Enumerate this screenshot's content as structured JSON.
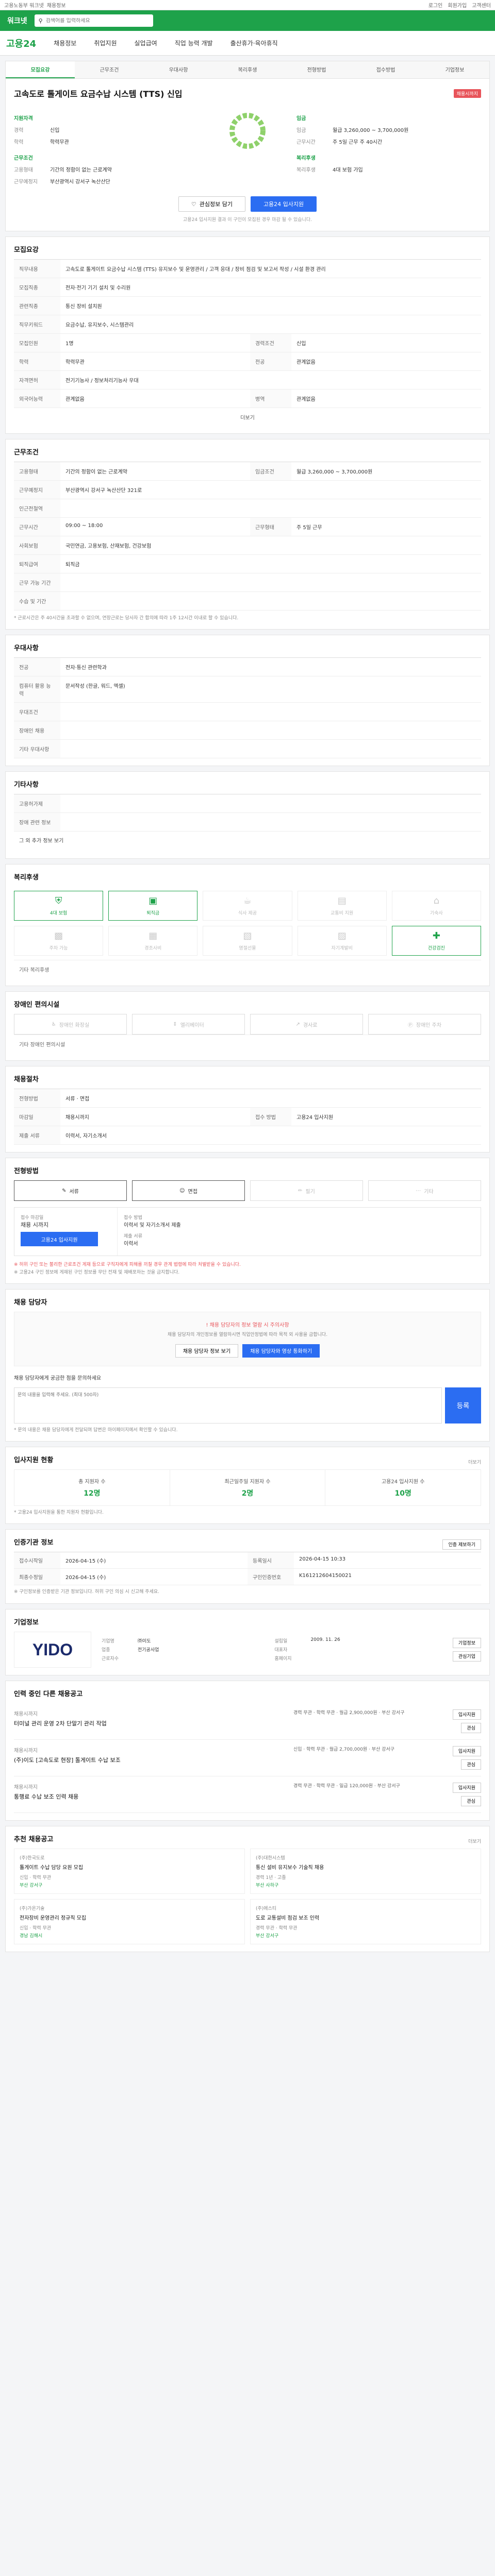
{
  "topbar": {
    "left": "고용노동부 워크넷",
    "crumb": "채용정보",
    "links": [
      "로그인",
      "회원가입",
      "고객센터"
    ]
  },
  "search": {
    "logo": "워크넷",
    "placeholder": "검색어를 입력하세요"
  },
  "gnb": {
    "brand": "고용24",
    "menus": [
      "채용정보",
      "취업지원",
      "실업급여",
      "직업 능력 개발",
      "출산휴가·육아휴직"
    ]
  },
  "head": {
    "tabs": [
      "모집요강",
      "근무조건",
      "우대사항",
      "복리후생",
      "전형방법",
      "접수방법",
      "기업정보"
    ],
    "title": "고속도로 톨게이트 요금수납 시스템 (TTS) 신입",
    "dday": "채용시까지",
    "section1": "지원자격",
    "kv1": [
      {
        "k": "경력",
        "v": "신입"
      },
      {
        "k": "학력",
        "v": "학력무관"
      }
    ],
    "section2": "근무조건",
    "kv2": [
      {
        "k": "고용형태",
        "v": "기간의 정함이 없는 근로계약"
      },
      {
        "k": "근무예정지",
        "v": "부산광역시 강서구 녹산산단"
      }
    ],
    "section3": "임금",
    "kv3": [
      {
        "k": "임금",
        "v": "월급 3,260,000 ~ 3,700,000원"
      },
      {
        "k": "근무시간",
        "v": "주 5일 근무 주 40시간"
      }
    ],
    "section4": "복리후생",
    "kv4": [
      {
        "k": "복리후생",
        "v": "4대 보험 가입"
      }
    ],
    "btn_scrap": "관심정보 담기",
    "btn_apply": "고용24 입사지원",
    "note": "고용24 입사지원 결과 이 구인이 모집된 경우 마감 될 수 있습니다."
  },
  "recruit": {
    "title": "모집요강",
    "rows": [
      {
        "k": "직무내용",
        "v": "고속도로 톨게이트 요금수납 시스템 (TTS) 유지보수 및 운영관리 / 고객 응대 / 장비 점검 및 보고서 작성 / 시설 환경 관리"
      },
      {
        "k": "모집직종",
        "v": "전자·전기 기기 설치 및 수리원"
      },
      {
        "k": "관련직종",
        "v": "통신 장비 설치원"
      },
      {
        "k": "직무키워드",
        "v": "요금수납, 유지보수, 시스템관리"
      },
      {
        "k": "모집인원",
        "v": "1명"
      },
      {
        "k": "경력조건",
        "v": "신입"
      },
      {
        "k": "학력",
        "v": "학력무관"
      },
      {
        "k": "전공",
        "v": "관계없음"
      },
      {
        "k": "자격면허",
        "v": "전기기능사 / 정보처리기능사 우대"
      },
      {
        "k": "외국어능력",
        "v": "관계없음"
      },
      {
        "k": "병역",
        "v": "관계없음"
      }
    ],
    "more": "더보기"
  },
  "work": {
    "title": "근무조건",
    "rows": [
      {
        "k": "고용형태",
        "v": "기간의 정함이 없는 근로계약"
      },
      {
        "k": "임금조건",
        "v": "월급 3,260,000 ~ 3,700,000원"
      },
      {
        "k": "근무예정지",
        "v": "부산광역시 강서구 녹산산단 321로"
      },
      {
        "k": "인근전철역",
        "v": ""
      },
      {
        "k": "근무시간",
        "v": "09:00 ~ 18:00"
      },
      {
        "k": "근무형태",
        "v": "주 5일 근무"
      },
      {
        "k": "사회보험",
        "v": "국민연금, 고용보험, 산재보험, 건강보험"
      },
      {
        "k": "퇴직급여",
        "v": "퇴직금"
      },
      {
        "k": "근무 가능 기간",
        "v": ""
      },
      {
        "k": "수습 및 기간",
        "v": ""
      }
    ],
    "note": "* 근로시간은 주 40시간을 초과할 수 없으며, 연장근로는 당사자 간 합의에 따라 1주 12시간 이내로 할 수 있습니다."
  },
  "pref": {
    "title": "우대사항",
    "rows": [
      {
        "k": "전공",
        "v": "전자·통신 관련학과"
      },
      {
        "k": "컴퓨터 활용 능력",
        "v": "문서작성 (한글, 워드, 엑셀)"
      },
      {
        "k": "우대조건",
        "v": ""
      },
      {
        "k": "장애인 채용",
        "v": ""
      },
      {
        "k": "기타 우대사항",
        "v": ""
      }
    ]
  },
  "etc": {
    "title": "기타사항",
    "rows": [
      {
        "k": "고용허가제",
        "v": ""
      },
      {
        "k": "장애 관련 정보",
        "v": ""
      }
    ],
    "link": "그 외 추가 정보 보기"
  },
  "welfare": {
    "title": "복리후생",
    "tiles": [
      {
        "label": "4대 보험",
        "icon": "shield-icon",
        "on": true
      },
      {
        "label": "퇴직금",
        "icon": "wallet-icon",
        "on": true
      },
      {
        "label": "식사 제공",
        "icon": "meal-icon",
        "on": false
      },
      {
        "label": "교통비 지원",
        "icon": "bus-icon",
        "on": false
      },
      {
        "label": "기숙사",
        "icon": "home-icon",
        "on": false
      },
      {
        "label": "주차 가능",
        "icon": "car-icon",
        "on": false
      },
      {
        "label": "경조사비",
        "icon": "gift-icon",
        "on": false
      },
      {
        "label": "명절선물",
        "icon": "present-icon",
        "on": false
      },
      {
        "label": "자기계발비",
        "icon": "book-icon",
        "on": false
      },
      {
        "label": "건강검진",
        "icon": "health-icon",
        "on": true
      }
    ],
    "etc_k": "기타 복리후생",
    "etc_v": ""
  },
  "disabled": {
    "title": "장애인 편의시설",
    "tiles": [
      {
        "label": "장애인 화장실",
        "icon": "toilet-icon"
      },
      {
        "label": "엘리베이터",
        "icon": "elevator-icon"
      },
      {
        "label": "경사로",
        "icon": "ramp-icon"
      },
      {
        "label": "장애인 주차",
        "icon": "parking-icon"
      }
    ],
    "etc_k": "기타 장애인 편의시설",
    "etc_v": ""
  },
  "hire": {
    "title": "채용절차",
    "rows": [
      {
        "k": "전형방법",
        "v": "서류 · 면접"
      },
      {
        "k": "마감일",
        "v": "채용시까지"
      },
      {
        "k": "접수 방법",
        "v": "고용24 입사지원"
      },
      {
        "k": "제출 서류",
        "v": "이력서, 자기소개서"
      }
    ]
  },
  "method": {
    "title": "전형방법",
    "items": [
      "서류",
      "면접",
      "필기",
      "기타"
    ],
    "on": [
      true,
      true,
      false,
      false
    ]
  },
  "apply": {
    "left_title": "접수 마감일",
    "left_value": "채용 시까지",
    "apply_btn": "고용24 입사지원",
    "right_title": "접수 방법",
    "right_value": "이력서 및 자기소개서 제출",
    "right_title2": "제출 서류",
    "right_value2": "이력서",
    "notice_red": "※ 허위 구인 또는 불리한 근로조건 게재 등으로 구직자에게 피해를 끼칠 경우 관계 법령에 따라 처벌받을 수 있습니다.",
    "notice_gray": "※ 고용24 구인 정보에 게재된 구인 정보를 무단 전재 및 재배포하는 것을 금지합니다."
  },
  "contact": {
    "title": "채용 담당자",
    "alert": "! 채용 담당자의 정보 열람 시 주의사항",
    "desc": "채용 담당자의 개인정보를 열람하시면 직업안정법에 따라 목적 외 사용을 금합니다.",
    "btn1": "채용 담당자 정보 보기",
    "btn2": "채용 담당자와 영상 통화하기",
    "qa_title": "채용 담당자에게 궁금한 점을 문의하세요",
    "qa_placeholder": "문의 내용을 입력해 주세요. (최대 500자)",
    "qa_btn": "등록",
    "list_note": "* 문의 내용은 채용 담당자에게 전달되며 답변은 마이페이지에서 확인할 수 있습니다."
  },
  "stats": {
    "title": "입사지원 현황",
    "link": "더보기",
    "items": [
      {
        "label": "총 지원자 수",
        "num": "12명"
      },
      {
        "label": "최근일주일 지원자 수",
        "num": "2명"
      },
      {
        "label": "고용24 입사지원 수",
        "num": "10명"
      }
    ],
    "note": "* 고용24 입사지원을 통한 지원자 현황입니다."
  },
  "dates": {
    "title": "인증기관 정보",
    "link": "인증 제보하기",
    "rows": [
      {
        "k": "접수시작일",
        "v": "2026-04-15 (수)"
      },
      {
        "k": "등록일시",
        "v": "2026-04-15 10:33"
      },
      {
        "k": "최종수정일",
        "v": "2026-04-15 (수)"
      },
      {
        "k": "구인인증번호",
        "v": "K161212604150021"
      }
    ],
    "notes": "※ 구인정보를 인증받은 기관 정보입니다. 허위 구인 의심 시 신고해 주세요."
  },
  "company": {
    "title": "기업정보",
    "logo": "YIDO",
    "kv": [
      {
        "k": "기업명",
        "v": "㈜이도"
      },
      {
        "k": "설립일",
        "v": "2009. 11. 26"
      },
      {
        "k": "업종",
        "v": "전기공사업"
      },
      {
        "k": "대표자",
        "v": ""
      },
      {
        "k": "근로자수",
        "v": ""
      },
      {
        "k": "홈페이지",
        "v": ""
      }
    ],
    "btn1": "기업정보",
    "btn2": "관심기업"
  },
  "others": {
    "title": "인력 중인 다른 채용공고",
    "items": [
      {
        "co": "채용시까지",
        "tt": "터미널 관리 운영 2차 단말기 관리 작업",
        "meta": "경력 무관 · 학력 무관 · 월급 2,900,000원 · 부산 강서구",
        "b1": "입사지원",
        "b2": "관심"
      },
      {
        "co": "채용시까지",
        "tt": "(주)이도 [고속도로 현장] 톨게이트 수납 보조",
        "meta": "신입 · 학력 무관 · 월급 2,700,000원 · 부산 강서구",
        "b1": "입사지원",
        "b2": "관심"
      },
      {
        "co": "채용시까지",
        "tt": "통행료 수납 보조 인력 채용",
        "meta": "경력 무관 · 학력 무관 · 일급 120,000원 · 부산 강서구",
        "b1": "입사지원",
        "b2": "관심"
      }
    ]
  },
  "recommend": {
    "title": "추천 채용공고",
    "link": "더보기",
    "items": [
      {
        "co": "(주)한국도로",
        "tt": "톨게이트 수납 담당 요원 모집",
        "mt": "신입 · 학력 무관",
        "mt2": "부산 강서구"
      },
      {
        "co": "(주)대한시스템",
        "tt": "통신 설비 유지보수 기술직 채용",
        "mt": "경력 1년 · 고졸",
        "mt2": "부산 사하구"
      },
      {
        "co": "(주)가온기술",
        "tt": "전자장비 운영관리 정규직 모집",
        "mt": "신입 · 학력 무관",
        "mt2": "경남 김해시"
      },
      {
        "co": "(주)에스티",
        "tt": "도로 교통설비 점검 보조 인력",
        "mt": "경력 무관 · 학력 무관",
        "mt2": "부산 강서구"
      }
    ]
  }
}
